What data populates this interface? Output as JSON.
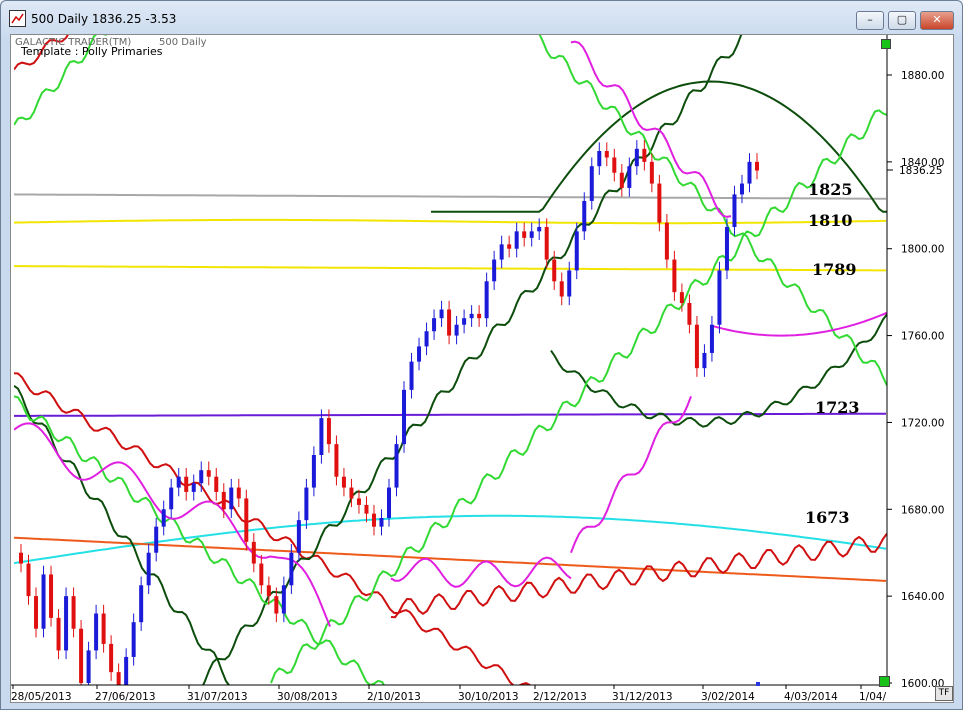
{
  "window": {
    "title": "500 Daily 1836.25   -3.53",
    "minimize": "–",
    "maximize": "▢",
    "close": "✕"
  },
  "chart_header": {
    "brand": "GALACTIC TRADER(TM)",
    "symbol": "500 Daily",
    "template": "Template : Polly Primaries"
  },
  "corner_button": "TF",
  "chart_data": {
    "type": "line",
    "title": "",
    "y_ticks": [
      "1880.00",
      "1840.00",
      "1800.00",
      "1760.00",
      "1720.00",
      "1680.00",
      "1640.00",
      "1600.00"
    ],
    "x_ticks": [
      "28/05/2013",
      "27/06/2013",
      "31/07/2013",
      "30/08/2013",
      "2/10/2013",
      "30/10/2013",
      "2/12/2013",
      "31/12/2013",
      "3/02/2014",
      "4/03/2014",
      "1/04/"
    ],
    "ylim": [
      1600,
      1890
    ],
    "current_price": "1836.25",
    "levels": [
      {
        "label": "1825",
        "value": 1825
      },
      {
        "label": "1810",
        "value": 1810
      },
      {
        "label": "1789",
        "value": 1789
      },
      {
        "label": "1723",
        "value": 1723
      },
      {
        "label": "1673",
        "value": 1673
      }
    ],
    "price_closes": [
      1655,
      1640,
      1625,
      1650,
      1630,
      1615,
      1640,
      1625,
      1600,
      1615,
      1632,
      1618,
      1605,
      1595,
      1612,
      1628,
      1645,
      1660,
      1672,
      1680,
      1690,
      1695,
      1688,
      1692,
      1698,
      1695,
      1688,
      1680,
      1690,
      1685,
      1665,
      1655,
      1645,
      1640,
      1632,
      1645,
      1660,
      1675,
      1690,
      1705,
      1722,
      1710,
      1695,
      1690,
      1685,
      1682,
      1678,
      1672,
      1676,
      1690,
      1710,
      1735,
      1748,
      1755,
      1762,
      1768,
      1772,
      1760,
      1765,
      1768,
      1770,
      1768,
      1785,
      1795,
      1802,
      1800,
      1808,
      1805,
      1808,
      1810,
      1795,
      1785,
      1778,
      1790,
      1808,
      1822,
      1838,
      1845,
      1842,
      1835,
      1828,
      1838,
      1846,
      1840,
      1830,
      1812,
      1795,
      1780,
      1775,
      1765,
      1745,
      1752,
      1765,
      1790,
      1810,
      1825,
      1830,
      1840,
      1836
    ]
  }
}
